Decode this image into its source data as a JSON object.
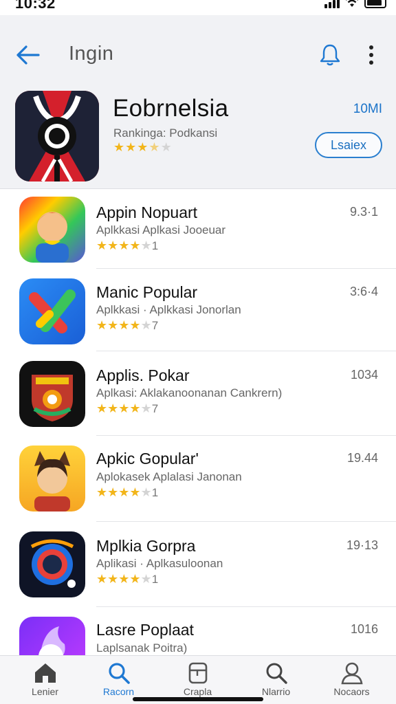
{
  "status_bar": {
    "time": "10:32"
  },
  "header": {
    "title": "Ingin",
    "back_icon": "arrow-left-icon",
    "bell_icon": "bell-icon",
    "more_icon": "more-vertical-icon"
  },
  "featured": {
    "name": "Eobrnelsia",
    "subtitle": "Rankinga: Podkansi",
    "rating": 3.5,
    "size": "10MI",
    "button_label": "Lsaiex"
  },
  "apps": [
    {
      "name": "Appin Nopuart",
      "description": "Aplkkasi Aplkasi Jooeuar",
      "rating": 4,
      "rating_suffix": "1",
      "meta": "9.3·1"
    },
    {
      "name": "Manic Popular",
      "description": "Aplkkasi · Aplkkasi Jonorlan",
      "rating": 4,
      "rating_suffix": "7",
      "meta": "3:6·4"
    },
    {
      "name": "Applis. Pokar",
      "description": "Aplkasi: Aklakanoonanan Cankrern)",
      "rating": 4,
      "rating_suffix": "7",
      "meta": "1034"
    },
    {
      "name": "Apkic Gopular'",
      "description": "Aplokasek Aplalasi Janonan",
      "rating": 4,
      "rating_suffix": "1",
      "meta": "19.44"
    },
    {
      "name": "Mplkia Gorpra",
      "description": "Aplikasi · Aplkasuloonan",
      "rating": 4,
      "rating_suffix": "1",
      "meta": "19·13"
    },
    {
      "name": "Lasre Poplaat",
      "description": "Laplsanak Poitra)",
      "rating": 0,
      "rating_suffix": "",
      "meta": "1016"
    }
  ],
  "tabs": [
    {
      "label": "Lenier",
      "icon": "home-icon",
      "active": false
    },
    {
      "label": "Racorn",
      "icon": "search-icon",
      "active": true
    },
    {
      "label": "Crapla",
      "icon": "apps-icon",
      "active": false
    },
    {
      "label": "Nlarrio",
      "icon": "search-icon",
      "active": false
    },
    {
      "label": "Nocaors",
      "icon": "profile-icon",
      "active": false
    }
  ],
  "colors": {
    "accent": "#1e78d2",
    "star": "#f2b51a",
    "header_bg": "#f1f2f5"
  }
}
